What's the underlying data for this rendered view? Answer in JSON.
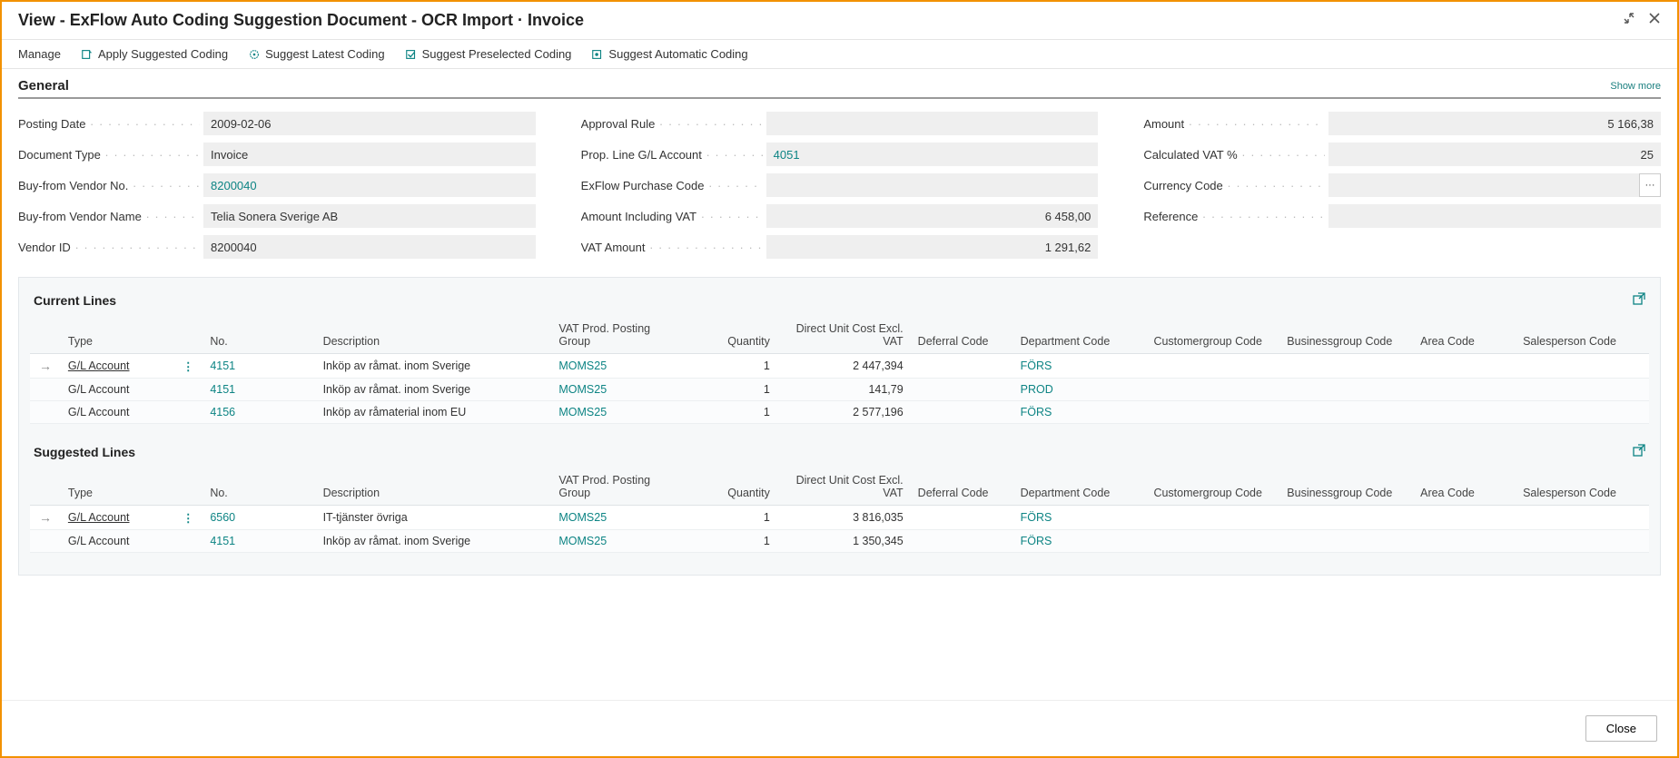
{
  "header": {
    "title": "View - ExFlow Auto Coding Suggestion Document - OCR Import · Invoice"
  },
  "toolbar": {
    "manage": "Manage",
    "apply": "Apply Suggested Coding",
    "suggest_latest": "Suggest Latest Coding",
    "suggest_preselected": "Suggest Preselected Coding",
    "suggest_automatic": "Suggest Automatic Coding"
  },
  "general": {
    "title": "General",
    "show_more": "Show more",
    "fields": {
      "posting_date": {
        "label": "Posting Date",
        "value": "2009-02-06"
      },
      "document_type": {
        "label": "Document Type",
        "value": "Invoice"
      },
      "buy_from_vendor_no": {
        "label": "Buy-from Vendor No.",
        "value": "8200040"
      },
      "buy_from_vendor_name": {
        "label": "Buy-from Vendor Name",
        "value": "Telia Sonera Sverige AB"
      },
      "vendor_id": {
        "label": "Vendor ID",
        "value": "8200040"
      },
      "approval_rule": {
        "label": "Approval Rule",
        "value": ""
      },
      "prop_line_gl_account": {
        "label": "Prop. Line G/L Account",
        "value": "4051"
      },
      "exflow_purchase_code": {
        "label": "ExFlow Purchase Code",
        "value": ""
      },
      "amount_including_vat": {
        "label": "Amount Including VAT",
        "value": "6 458,00"
      },
      "vat_amount": {
        "label": "VAT Amount",
        "value": "1 291,62"
      },
      "amount": {
        "label": "Amount",
        "value": "5 166,38"
      },
      "calculated_vat_pct": {
        "label": "Calculated VAT %",
        "value": "25"
      },
      "currency_code": {
        "label": "Currency Code",
        "value": ""
      },
      "reference": {
        "label": "Reference",
        "value": ""
      }
    }
  },
  "current_lines": {
    "title": "Current Lines",
    "columns": [
      "Type",
      "No.",
      "Description",
      "VAT Prod. Posting Group",
      "Quantity",
      "Direct Unit Cost Excl. VAT",
      "Deferral Code",
      "Department Code",
      "Customergroup Code",
      "Businessgroup Code",
      "Area Code",
      "Salesperson Code"
    ],
    "rows": [
      {
        "selected": true,
        "type": "G/L Account",
        "no": "4151",
        "description": "Inköp av råmat. inom Sverige",
        "vat_group": "MOMS25",
        "qty": "1",
        "unit_cost": "2 447,394",
        "deferral": "",
        "department": "FÖRS",
        "customergroup": "",
        "businessgroup": "",
        "area": "",
        "salesperson": ""
      },
      {
        "selected": false,
        "type": "G/L Account",
        "no": "4151",
        "description": "Inköp av råmat. inom Sverige",
        "vat_group": "MOMS25",
        "qty": "1",
        "unit_cost": "141,79",
        "deferral": "",
        "department": "PROD",
        "customergroup": "",
        "businessgroup": "",
        "area": "",
        "salesperson": ""
      },
      {
        "selected": false,
        "type": "G/L Account",
        "no": "4156",
        "description": "Inköp av råmaterial inom EU",
        "vat_group": "MOMS25",
        "qty": "1",
        "unit_cost": "2 577,196",
        "deferral": "",
        "department": "FÖRS",
        "customergroup": "",
        "businessgroup": "",
        "area": "",
        "salesperson": ""
      }
    ]
  },
  "suggested_lines": {
    "title": "Suggested Lines",
    "columns": [
      "Type",
      "No.",
      "Description",
      "VAT Prod. Posting Group",
      "Quantity",
      "Direct Unit Cost Excl. VAT",
      "Deferral Code",
      "Department Code",
      "Customergroup Code",
      "Businessgroup Code",
      "Area Code",
      "Salesperson Code"
    ],
    "rows": [
      {
        "selected": true,
        "type": "G/L Account",
        "no": "6560",
        "description": "IT-tjänster övriga",
        "vat_group": "MOMS25",
        "qty": "1",
        "unit_cost": "3 816,035",
        "deferral": "",
        "department": "FÖRS",
        "customergroup": "",
        "businessgroup": "",
        "area": "",
        "salesperson": ""
      },
      {
        "selected": false,
        "type": "G/L Account",
        "no": "4151",
        "description": "Inköp av råmat. inom Sverige",
        "vat_group": "MOMS25",
        "qty": "1",
        "unit_cost": "1 350,345",
        "deferral": "",
        "department": "FÖRS",
        "customergroup": "",
        "businessgroup": "",
        "area": "",
        "salesperson": ""
      }
    ]
  },
  "footer": {
    "close": "Close"
  }
}
